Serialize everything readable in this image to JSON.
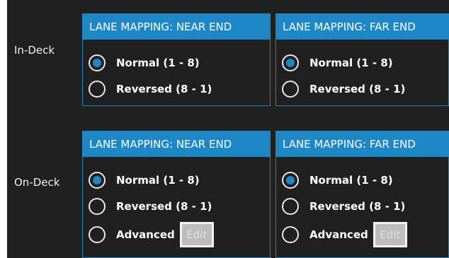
{
  "rows": [
    {
      "label": "In-Deck",
      "groups": [
        {
          "header": "LANE MAPPING: NEAR END",
          "options": [
            {
              "label": "Normal (1 - 8)",
              "checked": true
            },
            {
              "label": "Reversed (8 - 1)",
              "checked": false
            }
          ]
        },
        {
          "header": "LANE MAPPING: FAR END",
          "options": [
            {
              "label": "Normal (1 - 8)",
              "checked": true
            },
            {
              "label": "Reversed (8 - 1)",
              "checked": false
            }
          ]
        }
      ]
    },
    {
      "label": "On-Deck",
      "groups": [
        {
          "header": "LANE MAPPING: NEAR END",
          "options": [
            {
              "label": "Normal (1 - 8)",
              "checked": true
            },
            {
              "label": "Reversed (8 - 1)",
              "checked": false
            },
            {
              "label": "Advanced",
              "checked": false,
              "button": "Edit",
              "button_enabled": false
            }
          ]
        },
        {
          "header": "LANE MAPPING: FAR END",
          "options": [
            {
              "label": "Normal (1 - 8)",
              "checked": true
            },
            {
              "label": "Reversed (8 - 1)",
              "checked": false
            },
            {
              "label": "Advanced",
              "checked": false,
              "button": "Edit",
              "button_enabled": false
            }
          ]
        }
      ]
    }
  ],
  "colors": {
    "background": "#202020",
    "accent": "#1e88c7",
    "text": "#ffffff",
    "disabled_button": "#bdbdbd"
  },
  "icons": {
    "radio_checked": "radio-selected-icon",
    "radio_unchecked": "radio-unselected-icon"
  }
}
